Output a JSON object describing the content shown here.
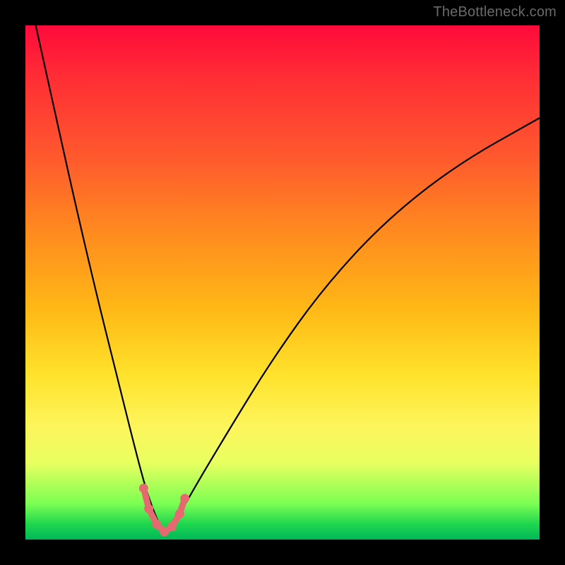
{
  "watermark": "TheBottleneck.com",
  "chart_data": {
    "type": "line",
    "title": "",
    "xlabel": "",
    "ylabel": "",
    "xlim": [
      0,
      100
    ],
    "ylim": [
      0,
      100
    ],
    "grid": false,
    "legend": false,
    "annotations": [],
    "background_gradient_stops": [
      {
        "pct": 0,
        "color": "#ff0a3a"
      },
      {
        "pct": 25,
        "color": "#ff572e"
      },
      {
        "pct": 55,
        "color": "#ffb816"
      },
      {
        "pct": 78,
        "color": "#fdf55c"
      },
      {
        "pct": 93,
        "color": "#7bff52"
      },
      {
        "pct": 100,
        "color": "#00b858"
      }
    ],
    "series": [
      {
        "name": "bottleneck-curve",
        "x": [
          2,
          6,
          10,
          14,
          18,
          22,
          24,
          26,
          27,
          28,
          30,
          34,
          40,
          48,
          58,
          70,
          84,
          100
        ],
        "y": [
          100,
          82,
          64,
          47,
          31,
          15,
          8,
          3,
          1,
          2,
          5,
          12,
          22,
          35,
          49,
          62,
          73,
          82
        ]
      }
    ],
    "markers": {
      "name": "optimal-range",
      "color": "#e46a6f",
      "x": [
        23.0,
        24.0,
        25.5,
        27.0,
        28.5,
        30.0,
        31.0
      ],
      "y": [
        10.0,
        6.0,
        3.0,
        1.5,
        2.5,
        5.0,
        8.0
      ]
    }
  }
}
